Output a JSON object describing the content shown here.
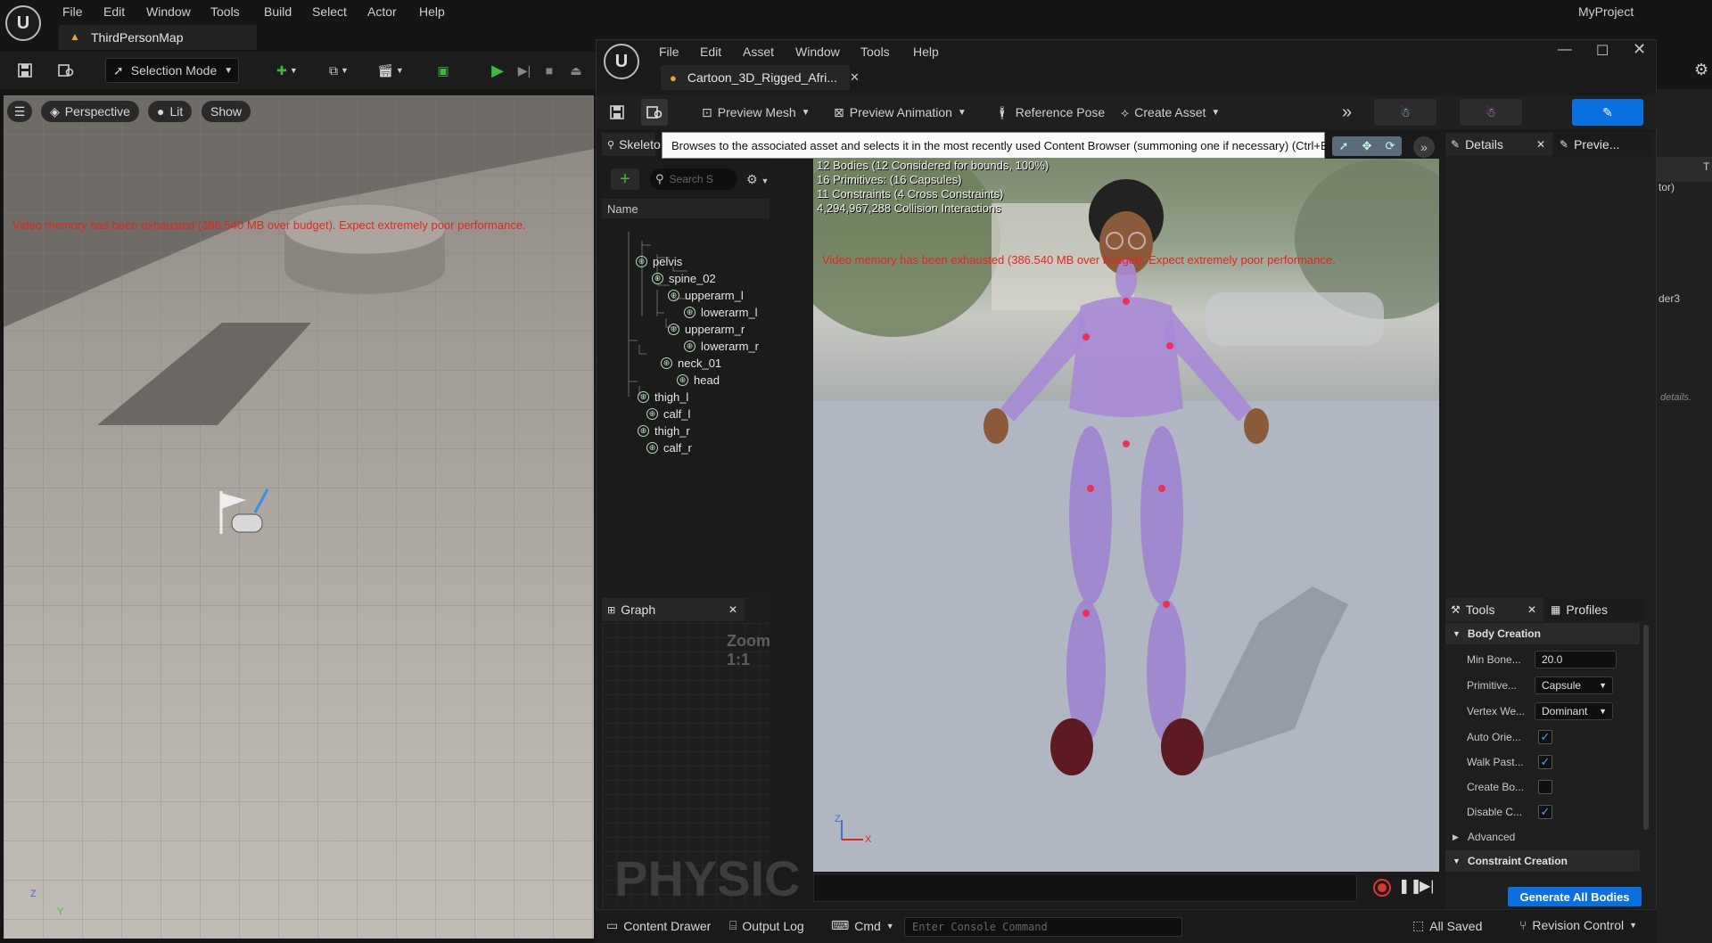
{
  "main_window": {
    "menu": [
      "File",
      "Edit",
      "Window",
      "Tools",
      "Build",
      "Select",
      "Actor",
      "Help"
    ],
    "project_name": "MyProject",
    "map_tab": "ThirdPersonMap",
    "selection_mode": "Selection Mode",
    "viewport": {
      "perspective": "Perspective",
      "lit": "Lit",
      "show": "Show",
      "warning": "Video memory has been exhausted (386.540 MB over budget). Expect extremely poor performance.",
      "axis_z": "Z",
      "axis_y": "Y"
    },
    "right_edge_fragments": [
      "tor)",
      "der3",
      "details.",
      "T"
    ]
  },
  "asset_editor": {
    "menu": [
      "File",
      "Edit",
      "Asset",
      "Window",
      "Tools",
      "Help"
    ],
    "tab_title": "Cartoon_3D_Rigged_Afri...",
    "toolbar": {
      "preview_mesh": "Preview Mesh",
      "preview_animation": "Preview Animation",
      "reference_pose": "Reference Pose",
      "create_asset": "Create Asset"
    },
    "tooltip": "Browses to the associated asset and selects it in the most recently used Content Browser (summoning one if necessary) (Ctrl+B)",
    "skeleton_panel": {
      "tab": "Skeleto",
      "search_placeholder": "Search S",
      "column_header": "Name",
      "bones": [
        "pelvis",
        "spine_02",
        "upperarm_l",
        "lowerarm_l",
        "upperarm_r",
        "lowerarm_r",
        "neck_01",
        "head",
        "thigh_l",
        "calf_l",
        "thigh_r",
        "calf_r"
      ]
    },
    "graph_panel": {
      "tab": "Graph",
      "zoom": "Zoom 1:1",
      "watermark": "PHYSIC"
    },
    "preview_viewport": {
      "stats": [
        "12 Bodies (12 Considered for bounds, 100%)",
        "16 Primitives: (16 Capsules)",
        "11 Constraints (4 Cross Constraints)",
        "4,294,967,288 Collision Interactions"
      ],
      "warning": "Video memory has been exhausted (386.540 MB over budget). Expect extremely poor performance.",
      "axis_z": "Z",
      "axis_x": "X"
    },
    "details_panel": {
      "tab_details": "Details",
      "tab_preview": "Previe..."
    },
    "tools_panel": {
      "tab_tools": "Tools",
      "tab_profiles": "Profiles",
      "body_creation_header": "Body Creation",
      "min_bone_label": "Min Bone...",
      "min_bone_value": "20.0",
      "primitive_label": "Primitive...",
      "primitive_value": "Capsule",
      "vertex_weight_label": "Vertex We...",
      "vertex_weight_value": "Dominant",
      "auto_orient_label": "Auto Orie...",
      "auto_orient_checked": true,
      "walk_past_label": "Walk Past...",
      "walk_past_checked": true,
      "create_body_label": "Create Bo...",
      "create_body_checked": false,
      "disable_c_label": "Disable C...",
      "disable_c_checked": true,
      "advanced_label": "Advanced",
      "constraint_creation_header": "Constraint Creation",
      "generate_button": "Generate All Bodies"
    },
    "bottom_bar": {
      "content_drawer": "Content Drawer",
      "output_log": "Output Log",
      "cmd": "Cmd",
      "console_placeholder": "Enter Console Command",
      "all_saved": "All Saved",
      "revision_control": "Revision Control"
    }
  },
  "colors": {
    "accent_blue": "#0a6fe0",
    "warning_red": "#e0281e",
    "play_green": "#3fb83f"
  }
}
